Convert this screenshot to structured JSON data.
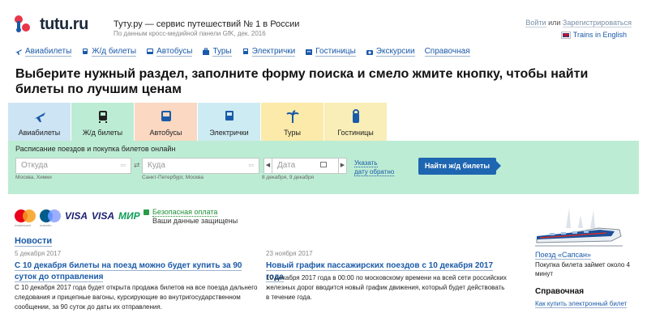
{
  "header": {
    "logo": "tutu.ru",
    "slogan": "Туту.ру — сервис путешествий № 1 в России",
    "slogan_sub": "По данным кросс-медийной панели GfK, дек. 2016",
    "login": "Войти",
    "or": "или",
    "register": "Зарегистрироваться",
    "lang_link": "Trains in English"
  },
  "topnav": [
    {
      "label": "Авиабилеты",
      "icon": "plane-icon"
    },
    {
      "label": "Ж/д билеты",
      "icon": "train-icon"
    },
    {
      "label": "Автобусы",
      "icon": "bus-icon"
    },
    {
      "label": "Туры",
      "icon": "suitcase-icon"
    },
    {
      "label": "Электрички",
      "icon": "commuter-train-icon"
    },
    {
      "label": "Гостиницы",
      "icon": "hotel-icon"
    },
    {
      "label": "Экскурсии",
      "icon": "camera-icon"
    },
    {
      "label": "Справочная",
      "icon": ""
    }
  ],
  "headline": "Выберите нужный раздел, заполните форму поиска и смело жмите кнопку, чтобы найти билеты по лучшим ценам",
  "tabs": [
    {
      "label": "Авиабилеты",
      "icon": "plane-icon",
      "color": "#cde4f4"
    },
    {
      "label": "Ж/д билеты",
      "icon": "train-icon",
      "color": "#bdecd4",
      "active": true
    },
    {
      "label": "Автобусы",
      "icon": "bus-icon",
      "color": "#fbd8c1"
    },
    {
      "label": "Электрички",
      "icon": "commuter-train-icon",
      "color": "#cdebf2"
    },
    {
      "label": "Туры",
      "icon": "palm-icon",
      "color": "#fbeaa9"
    },
    {
      "label": "Гостиницы",
      "icon": "door-hanger-icon",
      "color": "#f9eeb7"
    }
  ],
  "search": {
    "title": "Расписание поездов и покупка билетов онлайн",
    "from_placeholder": "Откуда",
    "from_hint": "Москва, Химки",
    "to_placeholder": "Куда",
    "to_hint": "Санкт-Петербург, Москва",
    "date_placeholder": "Дата",
    "date_hint": "8 декабря, 9 декабря",
    "back_line1": "Указать",
    "back_line2": "дату обратно",
    "button": "Найти ж/д билеты"
  },
  "payments": {
    "mc_caption": "mastercard",
    "maestro_caption": "maestro",
    "visa1": "VISA",
    "visa2": "VISA",
    "mir": "МИР",
    "secure_link": "Безопасная оплата",
    "secure_text": "Ваши данные защищены"
  },
  "news": {
    "heading": "Новости",
    "items": [
      {
        "date": "5 декабря 2017",
        "title": "С 10 декабря билеты на поезд можно будет купить за 90 суток до отправления",
        "text": "С 10 декабря 2017 года будет открыта продажа билетов на все поезда дальнего следования и прицепные вагоны, курсирующие во внутригосударственном сообщении, за 90 суток до даты их отправления."
      },
      {
        "date": "23 ноября 2017",
        "title": "Новый график пассажирских поездов с 10 декабря 2017 года",
        "text": "10 декабря 2017 года в 00:00 по московскому времени на всей сети российских железных дорог вводится новый график движения, который будет действовать в течение года."
      }
    ]
  },
  "sidebar": {
    "sapsan_link": "Поезд «Сапсан»",
    "sapsan_text": "Покупка билета займет около 4 минут",
    "sprav_title": "Справочная",
    "buy_link": "Как купить электронный билет"
  },
  "colors": {
    "link": "#1a5aa8",
    "button": "#1e66b2",
    "panel": "#bdecd4"
  }
}
